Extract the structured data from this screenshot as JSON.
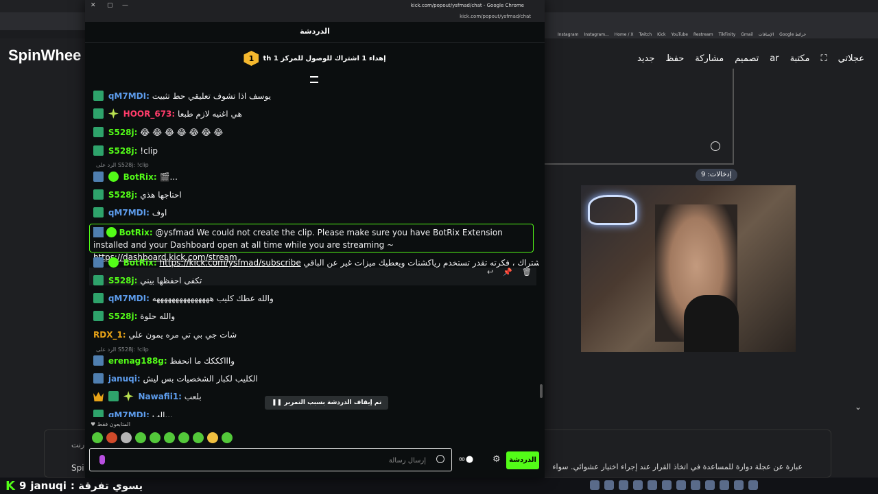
{
  "background_page": {
    "logo": "SpinWhee",
    "bookmarks": [
      "Instagram",
      "Instagram...",
      "Home / X",
      "Twitch",
      "Kick",
      "YouTube",
      "Restream",
      "TikFinity",
      "Gmail",
      "الإضافات",
      "Google خرائط"
    ],
    "toolbar": {
      "new_label": "جديد",
      "save_label": "حفظ",
      "share_label": "مشاركة",
      "design_label": "تصميم",
      "lang_label": "ar",
      "gallery_label": "مكتبة",
      "wheels_label": "عجلاتي"
    },
    "entries_badge": "إدخالات: 9",
    "description": "عبارة عن عجلة دوارة للمساعدة في اتخاذ القرار عند إجراء اختيار عشوائي. سواء",
    "left_text_1": "رنت",
    "left_text_2": "Spi"
  },
  "stream_overlay": {
    "count": "9",
    "user": "januqi",
    "message": ": يسوي تفرقة"
  },
  "popup": {
    "window_title": "kick.com/popout/ysfmad/chat - Google Chrome",
    "url": "kick.com/popout/ysfmad/chat",
    "chat_header": "الدردشة",
    "goal_rank": "1",
    "goal_text": "إهداء 1 اشتراك للوصول للمركز 1 th"
  },
  "messages": [
    {
      "user": "qM7MDI:",
      "color": "#5d9cec",
      "text": "يوسف اذا تشوف تعليقي حط تثبيت"
    },
    {
      "user": "HOOR_673:",
      "color": "#ff3c6a",
      "text": "هي اغنيه لازم طبعا"
    },
    {
      "user": "S528j:",
      "color": "#53fc18",
      "text": "😂 😂 😂 😂 😂 😂 😂"
    },
    {
      "user": "S528j:",
      "color": "#53fc18",
      "text": "!clip"
    },
    {
      "reply": "الرد على S528j: !clip"
    },
    {
      "user": "BotRix:",
      "color": "#53fc18",
      "text": "🎬..."
    },
    {
      "user": "S528j:",
      "color": "#53fc18",
      "text": "احتاجها هذي"
    },
    {
      "user": "qM7MDI:",
      "color": "#5d9cec",
      "text": "اوف"
    }
  ],
  "botrix_error": {
    "user": "BotRix:",
    "text": "@ysfmad We could not create the clip. Please make sure you have BotRix Extension installed and your Dashboard open at all time while you are streaming ~",
    "link": "https://dashboard.kick.com/stream"
  },
  "messages2": [
    {
      "user": "BotRix:",
      "color": "#53fc18",
      "link": "https://kick.com/ysfmad/subscribe",
      "text": "رابط الاشتراك ، فكرته تقدر تستخدم رياكشنات ويعطيك ميزات غير عن الباقي"
    },
    {
      "user": "S528j:",
      "color": "#53fc18",
      "text": "تكفى احفظها بيني"
    },
    {
      "user": "qM7MDI:",
      "color": "#5d9cec",
      "text": "والله عطك كليب هههههههههههههههه"
    },
    {
      "user": "S528j:",
      "color": "#53fc18",
      "text": "والله حلوة"
    },
    {
      "user": "RDX_1:",
      "color": "#e8a317",
      "text": "شات جي بي تي مره يمون علي"
    },
    {
      "reply": "الرد على S528j: !clip"
    },
    {
      "user": "erenag188g:",
      "color": "#53fc18",
      "text": "واااكككك ما انحفظ"
    },
    {
      "user": "januqi:",
      "color": "#5d9cec",
      "text": "الكليب لكبار الشخصيات بس ليش"
    },
    {
      "user": "Nawafii1:",
      "color": "#5d9cec",
      "text": "بلعب"
    },
    {
      "user": "qM7MDI:",
      "color": "#5d9cec",
      "text": "الب..."
    }
  ],
  "chat_paused": "تم إيقاف الدردشة بسبب التمرير",
  "followers_only": "المتابعون فقط",
  "input": {
    "placeholder": "إرسال رسالة"
  },
  "chat_button": "الدردشة",
  "icons": [
    "close-icon",
    "pin-icon",
    "delete-icon",
    "reply-icon",
    "emoji-icon",
    "settings-icon",
    "points-icon",
    "heart-icon"
  ]
}
